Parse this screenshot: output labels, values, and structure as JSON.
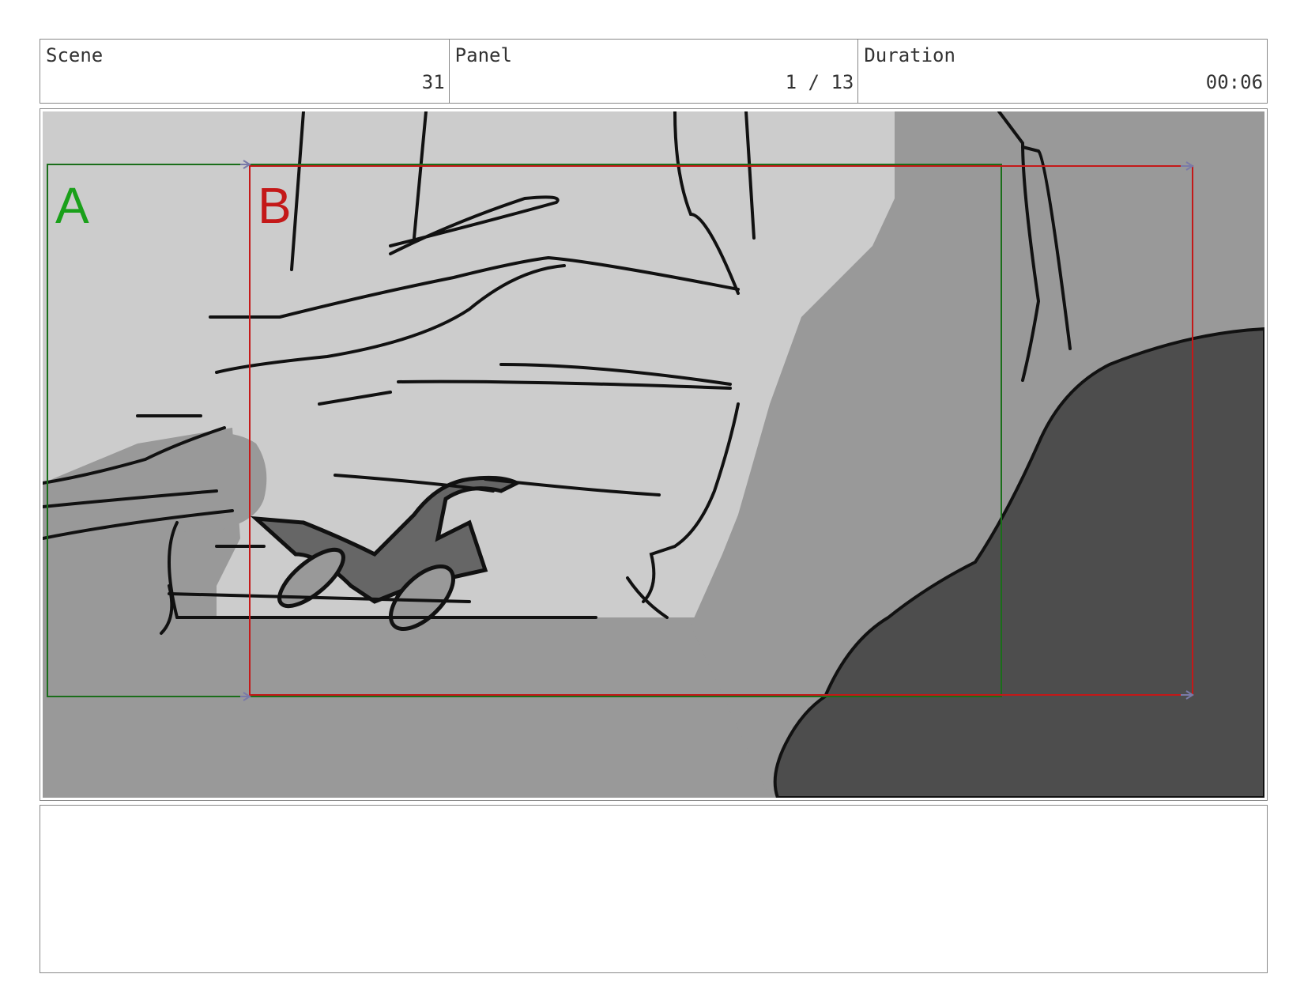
{
  "header": {
    "scene_label": "Scene",
    "scene_value": "31",
    "panel_label": "Panel",
    "panel_value": "1 / 13",
    "duration_label": "Duration",
    "duration_value": "00:06"
  },
  "frames": {
    "a_label": "A",
    "a_color": "#1aa01a",
    "b_label": "B",
    "b_color": "#c41818"
  },
  "colors": {
    "light_gray": "#cccccc",
    "mid_gray": "#999999",
    "dark_gray": "#4d4d4d",
    "ink": "#111111"
  },
  "notes": {
    "text": ""
  }
}
